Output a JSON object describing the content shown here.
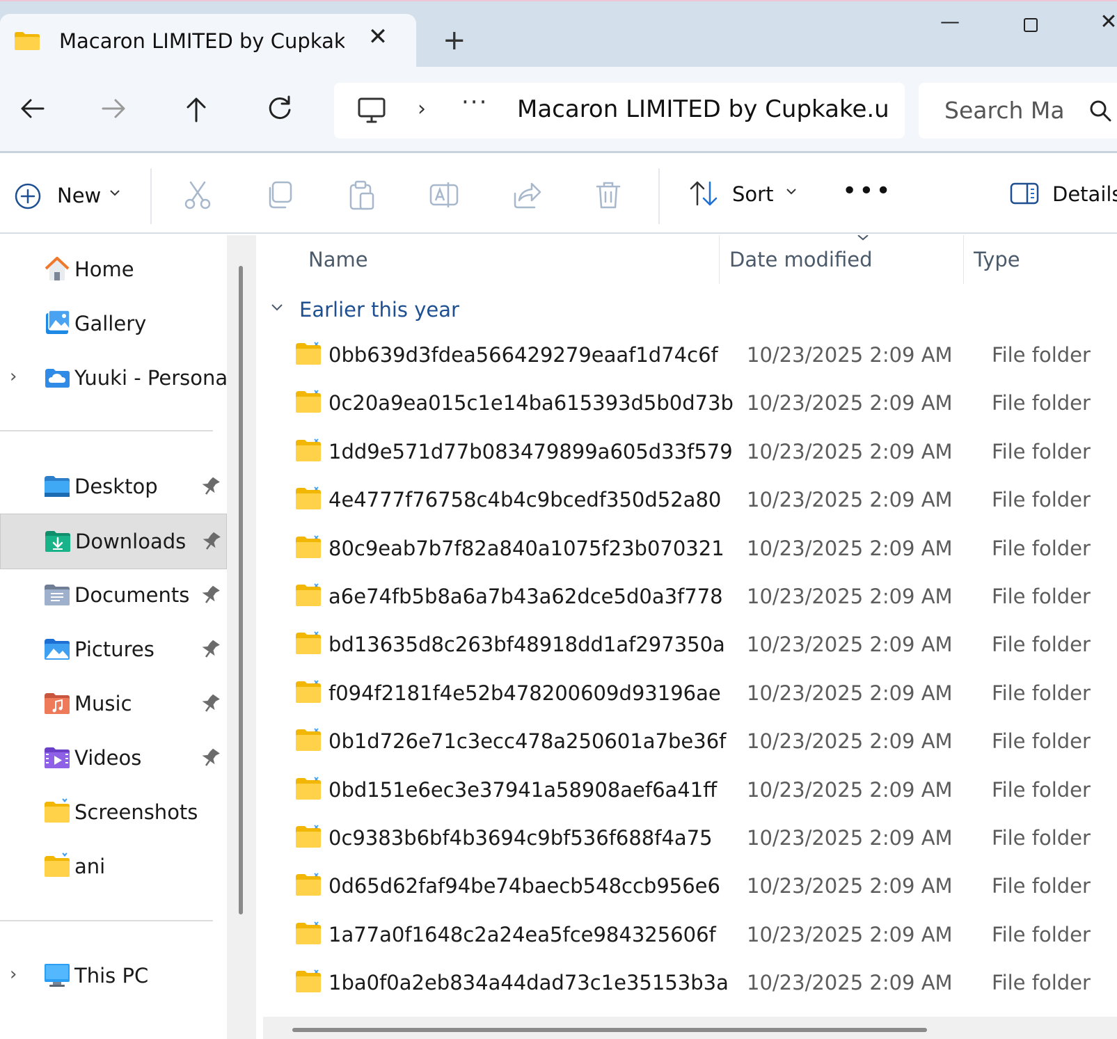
{
  "window": {
    "tab_title": "Macaron LIMITED by Cupkake",
    "new_tab_glyph": "+",
    "close_tab_glyph": "✕",
    "minimize_glyph": "—",
    "close_glyph": "✕"
  },
  "nav": {
    "address_path": "Macaron LIMITED by Cupkake.u",
    "address_more": "···",
    "address_separator": "›",
    "search_placeholder": "Search Ma"
  },
  "commands": {
    "new_label": "New",
    "sort_label": "Sort",
    "more_glyph": "•••",
    "details_label": "Details"
  },
  "sidebar": {
    "top_items": [
      {
        "label": "Home",
        "icon": "home-icon"
      },
      {
        "label": "Gallery",
        "icon": "gallery-icon"
      },
      {
        "label": "Yuuki - Personal",
        "icon": "onedrive-icon",
        "expander": "›"
      }
    ],
    "quick_access": [
      {
        "label": "Desktop",
        "icon": "desktop-folder-icon",
        "pinned": true
      },
      {
        "label": "Downloads",
        "icon": "downloads-folder-icon",
        "pinned": true,
        "selected": true
      },
      {
        "label": "Documents",
        "icon": "documents-folder-icon",
        "pinned": true
      },
      {
        "label": "Pictures",
        "icon": "pictures-folder-icon",
        "pinned": true
      },
      {
        "label": "Music",
        "icon": "music-folder-icon",
        "pinned": true
      },
      {
        "label": "Videos",
        "icon": "videos-folder-icon",
        "pinned": true
      },
      {
        "label": "Screenshots",
        "icon": "folder-icon",
        "pinned": false
      },
      {
        "label": "ani",
        "icon": "folder-icon",
        "pinned": false
      }
    ],
    "this_pc": {
      "label": "This PC",
      "icon": "this-pc-icon",
      "expander": "›"
    }
  },
  "list": {
    "columns": {
      "name": "Name",
      "date": "Date modified",
      "type": "Type"
    },
    "group_label": "Earlier this year",
    "rows": [
      {
        "name": "0bb639d3fdea566429279eaaf1d74c6f",
        "date": "10/23/2025 2:09 AM",
        "type": "File folder"
      },
      {
        "name": "0c20a9ea015c1e14ba615393d5b0d73b",
        "date": "10/23/2025 2:09 AM",
        "type": "File folder"
      },
      {
        "name": "1dd9e571d77b083479899a605d33f579",
        "date": "10/23/2025 2:09 AM",
        "type": "File folder"
      },
      {
        "name": "4e4777f76758c4b4c9bcedf350d52a80",
        "date": "10/23/2025 2:09 AM",
        "type": "File folder"
      },
      {
        "name": "80c9eab7b7f82a840a1075f23b070321",
        "date": "10/23/2025 2:09 AM",
        "type": "File folder"
      },
      {
        "name": "a6e74fb5b8a6a7b43a62dce5d0a3f778",
        "date": "10/23/2025 2:09 AM",
        "type": "File folder"
      },
      {
        "name": "bd13635d8c263bf48918dd1af297350a",
        "date": "10/23/2025 2:09 AM",
        "type": "File folder"
      },
      {
        "name": "f094f2181f4e52b478200609d93196ae",
        "date": "10/23/2025 2:09 AM",
        "type": "File folder"
      },
      {
        "name": "0b1d726e71c3ecc478a250601a7be36f",
        "date": "10/23/2025 2:09 AM",
        "type": "File folder"
      },
      {
        "name": "0bd151e6ec3e37941a58908aef6a41ff",
        "date": "10/23/2025 2:09 AM",
        "type": "File folder"
      },
      {
        "name": "0c9383b6bf4b3694c9bf536f688f4a75",
        "date": "10/23/2025 2:09 AM",
        "type": "File folder"
      },
      {
        "name": "0d65d62faf94be74baecb548ccb956e6",
        "date": "10/23/2025 2:09 AM",
        "type": "File folder"
      },
      {
        "name": "1a77a0f1648c2a24ea5fce984325606f",
        "date": "10/23/2025 2:09 AM",
        "type": "File folder"
      },
      {
        "name": "1ba0f0a2eb834a44dad73c1e35153b3a",
        "date": "10/23/2025 2:09 AM",
        "type": "File folder"
      }
    ]
  },
  "colors": {
    "titlebar": "#d3e0ec",
    "navbar": "#f3f6fa",
    "accent": "#1d4f91",
    "folder_yellow": "#ffd24a",
    "selection": "#e0e0e0"
  }
}
